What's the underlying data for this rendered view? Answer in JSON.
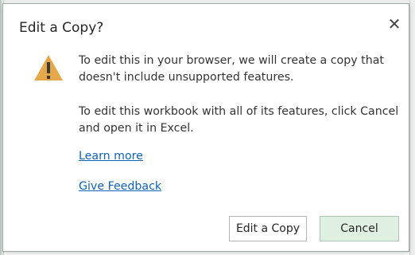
{
  "dialog": {
    "title": "Edit a Copy?",
    "close_glyph": "✕",
    "icon": "warning-icon",
    "message1": "To edit this in your browser, we will create a copy that doesn't include unsupported features.",
    "message2": "To edit this workbook with all of its features, click Cancel and open it in Excel.",
    "links": {
      "learn_more": "Learn more",
      "give_feedback": "Give Feedback"
    },
    "buttons": {
      "edit_copy": "Edit a Copy",
      "cancel": "Cancel"
    }
  },
  "colors": {
    "link": "#0f62b6",
    "warning_fill": "#e4a84b",
    "primary_button_bg": "#dff0e3"
  }
}
